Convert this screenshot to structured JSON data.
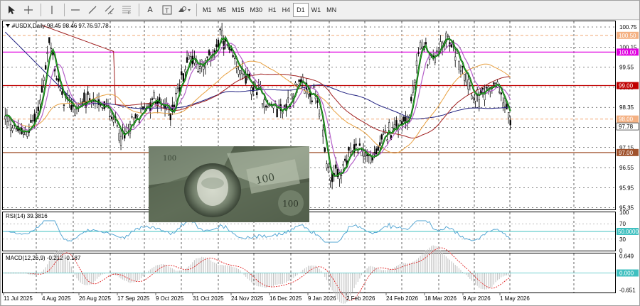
{
  "toolbar": {
    "tools": [
      {
        "name": "cursor-icon"
      },
      {
        "name": "crosshair-icon"
      },
      {
        "name": "vertical-line-icon"
      },
      {
        "name": "horizontal-line-icon"
      },
      {
        "name": "trendline-icon"
      },
      {
        "name": "equidistant-channel-icon"
      },
      {
        "name": "fibonacci-icon"
      },
      {
        "name": "text-icon",
        "label": "A"
      },
      {
        "name": "text-label-icon"
      },
      {
        "name": "shapes-icon"
      }
    ],
    "timeframes": [
      "M1",
      "M5",
      "M15",
      "M30",
      "H1",
      "H4",
      "D1",
      "W1",
      "MN"
    ],
    "active_timeframe": "D1"
  },
  "chart_header": {
    "symbol_line": "#USDX,Daily  98.45 98.46 97.76 97.78"
  },
  "price_axis": {
    "labels": [
      "100.75",
      "100.15",
      "99.55",
      "98.95",
      "98.35",
      "97.75",
      "97.15",
      "96.55",
      "95.95",
      "95.35"
    ],
    "tags": [
      {
        "value": "100.50",
        "bg": "#f4b183",
        "fg": "#ffffff"
      },
      {
        "value": "100.00",
        "bg": "#e000e0",
        "fg": "#ffffff"
      },
      {
        "value": "99.00",
        "bg": "#c00000",
        "fg": "#ffffff"
      },
      {
        "value": "98.00",
        "bg": "#f4b183",
        "fg": "#ffffff"
      },
      {
        "value": "97.78",
        "bg": "#ffffff",
        "fg": "#000000"
      },
      {
        "value": "97.00",
        "bg": "#a0522d",
        "fg": "#ffffff"
      }
    ]
  },
  "rsi": {
    "label": "RSI(14) 39.3816",
    "axis": [
      "100",
      "70",
      "50.0000",
      "30",
      "0"
    ]
  },
  "macd": {
    "label": "MACD(12,26,9) -0.212 -0.187",
    "axis": [
      "0.649",
      "0.000",
      "-0.651"
    ]
  },
  "time_axis": {
    "labels": [
      "11 Jul 2025",
      "4 Aug 2025",
      "26 Aug 2025",
      "17 Sep 2025",
      "9 Oct 2025",
      "31 Oct 2025",
      "24 Nov 2025",
      "16 Dec 2025",
      "9 Jan 2026",
      "2 Feb 2026",
      "24 Feb 2026",
      "18 Mar 2026",
      "9 Apr 2026",
      "1 May 2026"
    ]
  },
  "colors": {
    "candle": "#000000",
    "ma_fast": "#008000",
    "ma_mid": "#b45fc8",
    "ma_slow_orange": "#e8a040",
    "ma_slow_red": "#a02020",
    "ma_slow_navy": "#202080",
    "rsi_line": "#4aa0d0",
    "macd_hist": "#c0c0c0",
    "macd_signal": "#e02020"
  }
}
